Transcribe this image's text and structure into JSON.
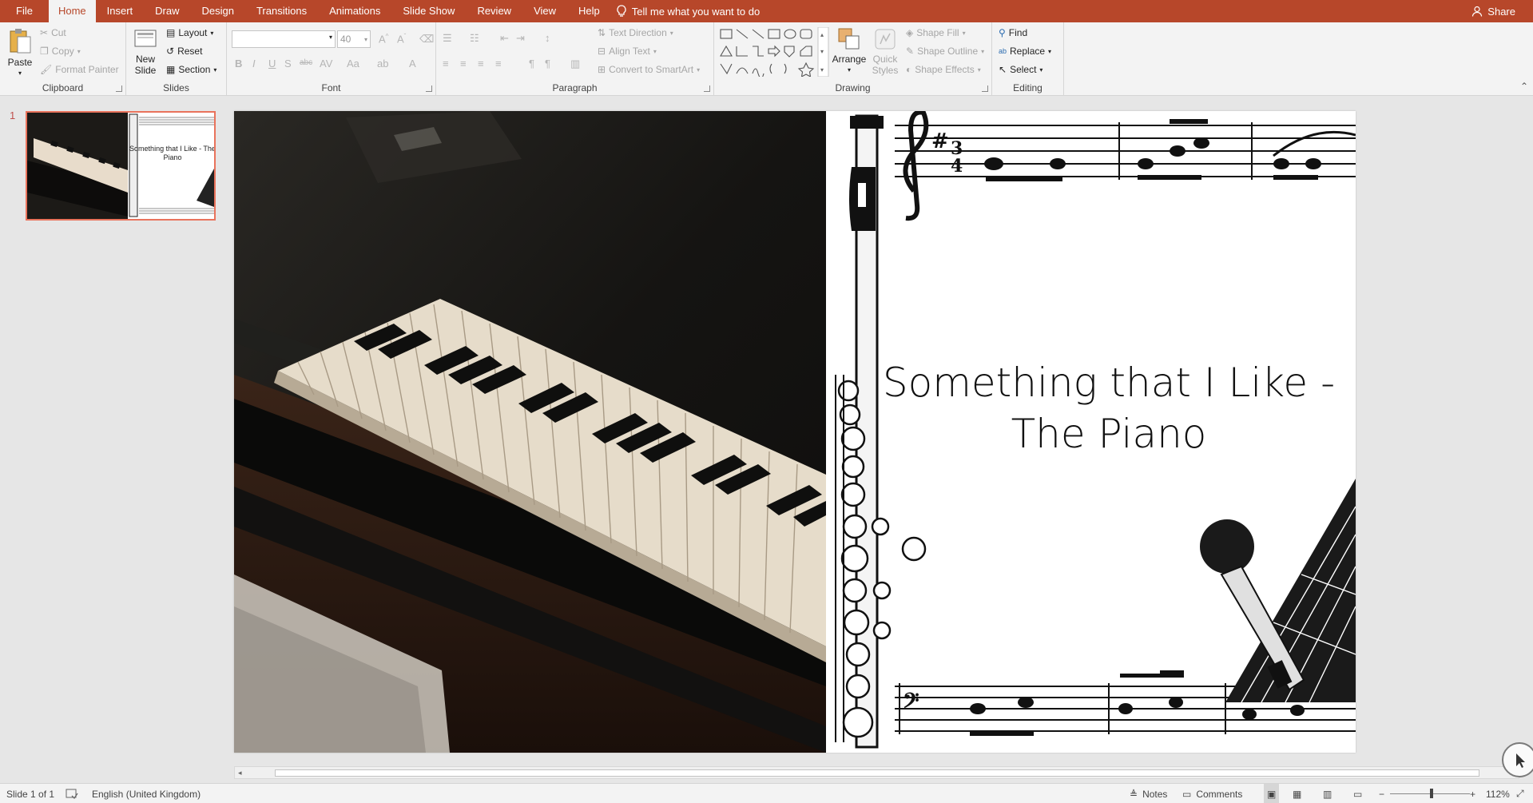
{
  "tabs": [
    {
      "label": "File"
    },
    {
      "label": "Home"
    },
    {
      "label": "Insert"
    },
    {
      "label": "Draw"
    },
    {
      "label": "Design"
    },
    {
      "label": "Transitions"
    },
    {
      "label": "Animations"
    },
    {
      "label": "Slide Show"
    },
    {
      "label": "Review"
    },
    {
      "label": "View"
    },
    {
      "label": "Help"
    }
  ],
  "active_tab": "Home",
  "tell_me": "Tell me what you want to do",
  "share": "Share",
  "ribbon": {
    "clipboard": {
      "paste": "Paste",
      "cut": "Cut",
      "copy": "Copy",
      "format_painter": "Format Painter",
      "label": "Clipboard"
    },
    "slides": {
      "new_slide_1": "New",
      "new_slide_2": "Slide",
      "layout": "Layout",
      "reset": "Reset",
      "section": "Section",
      "label": "Slides"
    },
    "font": {
      "font_name": "",
      "font_size": "40",
      "label": "Font"
    },
    "paragraph": {
      "text_direction": "Text Direction",
      "align_text": "Align Text",
      "convert_smartart": "Convert to SmartArt",
      "label": "Paragraph"
    },
    "drawing": {
      "arrange": "Arrange",
      "quick_styles_1": "Quick",
      "quick_styles_2": "Styles",
      "shape_fill": "Shape Fill",
      "shape_outline": "Shape Outline",
      "shape_effects": "Shape Effects",
      "label": "Drawing"
    },
    "editing": {
      "find": "Find",
      "replace": "Replace",
      "select": "Select",
      "label": "Editing"
    }
  },
  "thumbnail": {
    "number": "1",
    "title_line": "Something that I Like - The Piano"
  },
  "slide": {
    "title_line1": "Something that I Like -",
    "title_line2": "The Piano"
  },
  "status": {
    "slide_info": "Slide 1 of 1",
    "language": "English (United Kingdom)",
    "notes": "Notes",
    "comments": "Comments",
    "zoom": "112%"
  },
  "colors": {
    "accent": "#b7472a",
    "ribbon_bg": "#f3f3f3",
    "workspace_bg": "#e6e6e6",
    "thumb_border": "#e9735c"
  }
}
